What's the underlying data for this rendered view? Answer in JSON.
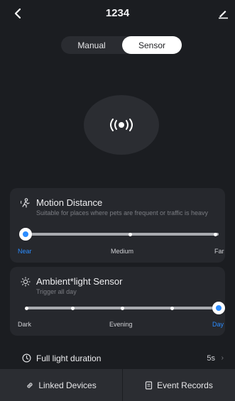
{
  "header": {
    "title": "1234",
    "back_icon": "chevron-left-icon",
    "edit_icon": "pencil-icon"
  },
  "mode": {
    "tabs": [
      "Manual",
      "Sensor"
    ],
    "selected": "Sensor"
  },
  "sensor_icon": "motion-sensor-icon",
  "motion_distance": {
    "title": "Motion Distance",
    "subtitle": "Suitable for places where pets are frequent or traffic is heavy",
    "icon": "motion-person-icon",
    "labels": [
      "Near",
      "Medium",
      "Far"
    ],
    "selected": "Near"
  },
  "ambient_light": {
    "title": "Ambient*light Sensor",
    "subtitle": "Trigger all day",
    "icon": "sun-icon",
    "labels": [
      "Dark",
      "Evening",
      "Day"
    ],
    "selected": "Day"
  },
  "full_light": {
    "label": "Full light duration",
    "value": "5s",
    "icon": "clock-icon",
    "chevron": "chevron-right-icon"
  },
  "bottom": {
    "linked_label": "Linked Devices",
    "linked_icon": "link-icon",
    "events_label": "Event Records",
    "events_icon": "document-icon"
  },
  "colors": {
    "accent": "#2b8cff",
    "background": "#1b1d21",
    "card": "#26282d"
  }
}
